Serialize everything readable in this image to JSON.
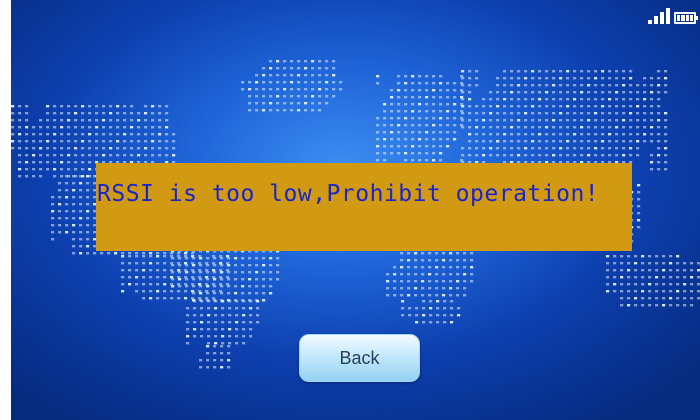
{
  "alert": {
    "message": "RSSI is too low,Prohibit operation!"
  },
  "buttons": {
    "back_label": "Back"
  },
  "status_bar": {
    "icons": [
      "signal-strength-icon",
      "battery-icon"
    ]
  },
  "colors": {
    "background": "#1f64d8",
    "alert_background": "#d29a12",
    "alert_text": "#1a26c8",
    "button_background": "#c3e9fb"
  }
}
